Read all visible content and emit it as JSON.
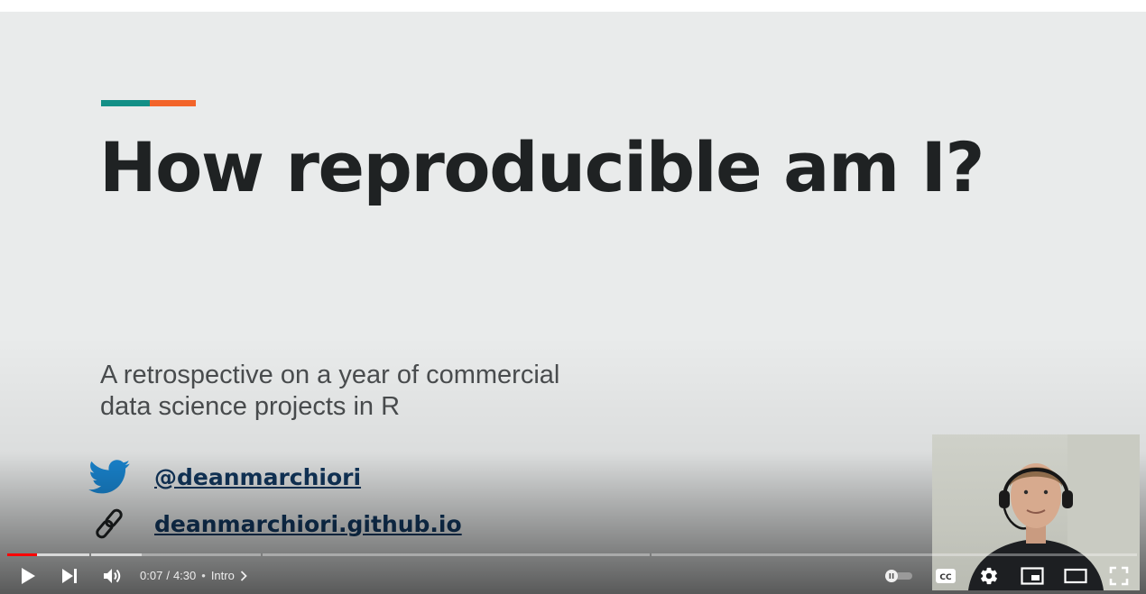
{
  "slide": {
    "title": "How reproducible am I?",
    "subtitle": "A retrospective on a year of commercial data science projects in R",
    "twitter_handle": "@deanmarchiori",
    "website": "deanmarchiori.github.io",
    "accent_colors": {
      "teal": "#138f86",
      "orange": "#f2642a"
    },
    "twitter_color": "#1a8ad8",
    "link_color": "#123860"
  },
  "player": {
    "current_time": "0:07",
    "separator": "/",
    "duration": "4:30",
    "chapter": "Intro",
    "progress_fraction": 0.026,
    "icons": {
      "play": "play-icon",
      "next": "next-icon",
      "volume": "volume-icon",
      "autoplay": "autoplay-toggle-icon",
      "captions": "captions-icon",
      "settings": "gear-icon",
      "miniplayer": "miniplayer-icon",
      "theater": "theater-mode-icon",
      "fullscreen": "fullscreen-icon"
    }
  }
}
